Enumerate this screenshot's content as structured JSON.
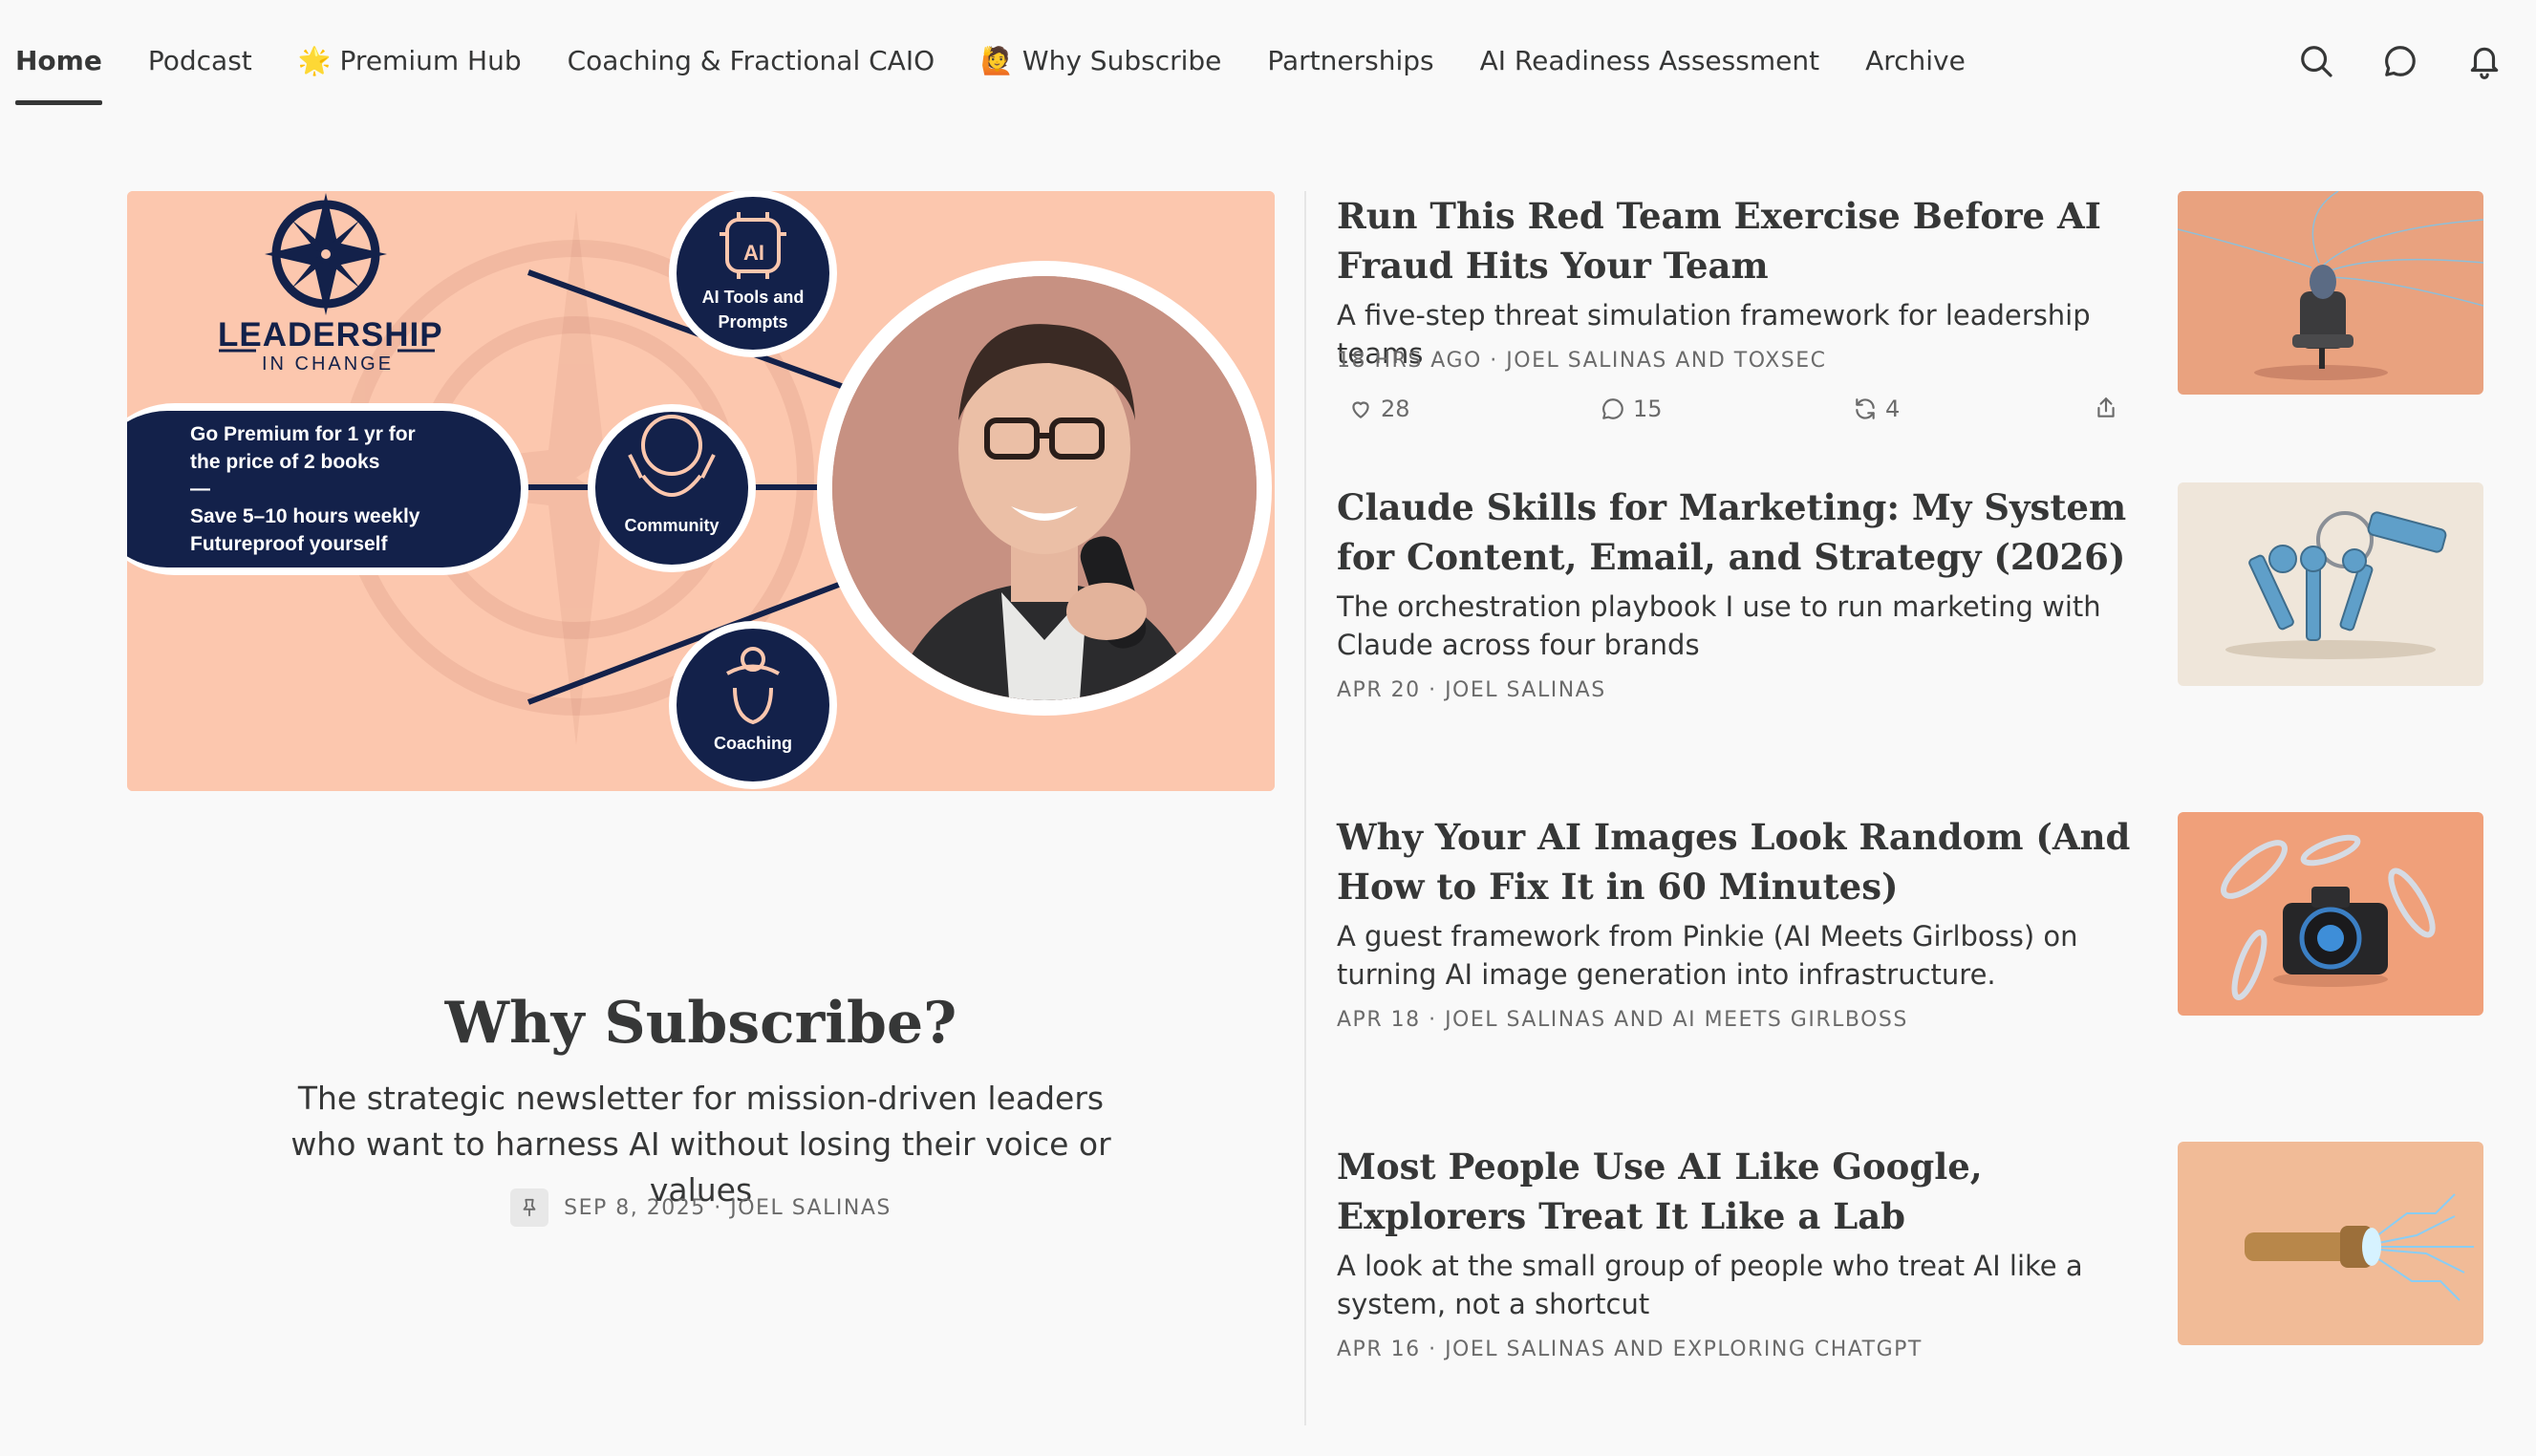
{
  "nav": {
    "tabs": [
      {
        "label": "Home"
      },
      {
        "label": "Podcast"
      },
      {
        "label": "🌟 Premium Hub"
      },
      {
        "label": "Coaching & Fractional CAIO"
      },
      {
        "label": "🙋 Why Subscribe"
      },
      {
        "label": "Partnerships"
      },
      {
        "label": "AI Readiness Assessment"
      },
      {
        "label": "Archive"
      }
    ],
    "icons": [
      "search-icon",
      "chat-icon",
      "bell-icon"
    ]
  },
  "hero": {
    "image": {
      "brand_top": "LEADERSHIP",
      "brand_bottom": "IN CHANGE",
      "badge_ai": "AI",
      "node_tools": "AI Tools and Prompts",
      "node_community": "Community",
      "node_coaching": "Coaching",
      "promo_line1": "Go Premium for 1 yr for",
      "promo_line2": "the price of 2 books",
      "promo_dash": "—",
      "promo_line3": "Save 5–10 hours weekly",
      "promo_line4": "Futureproof yourself",
      "colors": {
        "background": "#fcc7ae",
        "navy": "#13214a"
      }
    },
    "title": "Why Subscribe?",
    "subtitle": "The strategic newsletter for mission-driven leaders who want to harness AI without losing their voice or values",
    "meta": "SEP 8, 2025 · JOEL SALINAS"
  },
  "posts": [
    {
      "title": "Run This Red Team Exercise Before AI Fraud Hits Your Team",
      "subtitle": "A five-step threat simulation framework for leadership teams",
      "meta": "18 HRS AGO · JOEL SALINAS AND TOXSEC",
      "likes": "28",
      "comments": "15",
      "restacks": "4"
    },
    {
      "title": "Claude Skills for Marketing: My System for Content, Email, and Strategy (2026)",
      "subtitle": "The orchestration playbook I use to run marketing with Claude across four brands",
      "meta": "APR 20 · JOEL SALINAS"
    },
    {
      "title": "Why Your AI Images Look Random (And How to Fix It in 60 Minutes)",
      "subtitle": "A guest framework from Pinkie (AI Meets Girlboss) on turning AI image generation into infrastructure.",
      "meta": "APR 18 · JOEL SALINAS AND AI MEETS GIRLBOSS"
    },
    {
      "title": "Most People Use AI Like Google, Explorers Treat It Like a Lab",
      "subtitle": "A look at the small group of people who treat AI like a system, not a shortcut",
      "meta": "APR 16 · JOEL SALINAS AND EXPLORING CHATGPT"
    }
  ]
}
